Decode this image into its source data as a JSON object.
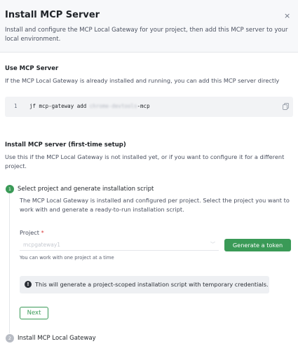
{
  "header": {
    "title": "Install MCP Server",
    "close_icon": "×",
    "subtitle": "Install and configure the MCP Local Gateway for your project, then add this MCP server to your local environment."
  },
  "use_section": {
    "title": "Use MCP Server",
    "description": "If the MCP Local Gateway is already installed and running, you can add this MCP server directly",
    "code": {
      "line_number": "1",
      "command": "jf mcp-gateway add ",
      "blurred_part": "chrome-devtools",
      "suffix": "-mcp"
    }
  },
  "install_section": {
    "title": "Install MCP server (first-time setup)",
    "description": "Use this if the MCP Local Gateway is not installed yet, or if you want to configure it for a different project."
  },
  "steps": [
    {
      "number": "1",
      "title": "Select project and generate installation script",
      "description": "The MCP Local Gateway is installed and configured per project. Select the project you want to work with and generate a ready-to-run installation script."
    },
    {
      "number": "2",
      "title": "Install MCP Local Gateway"
    }
  ],
  "form": {
    "project_label": "Project",
    "required_mark": "*",
    "project_value": "mcpgateway1",
    "generate_label": "Generate a token",
    "hint": "You can work with one project at a time",
    "info_text": "This will generate a project-scoped installation script with temporary credentials.",
    "next_label": "Next"
  },
  "colors": {
    "accent": "#3a9a57",
    "step_active": "#3a9a57",
    "step_inactive": "#b8bcc4",
    "required": "#d93b3b"
  }
}
